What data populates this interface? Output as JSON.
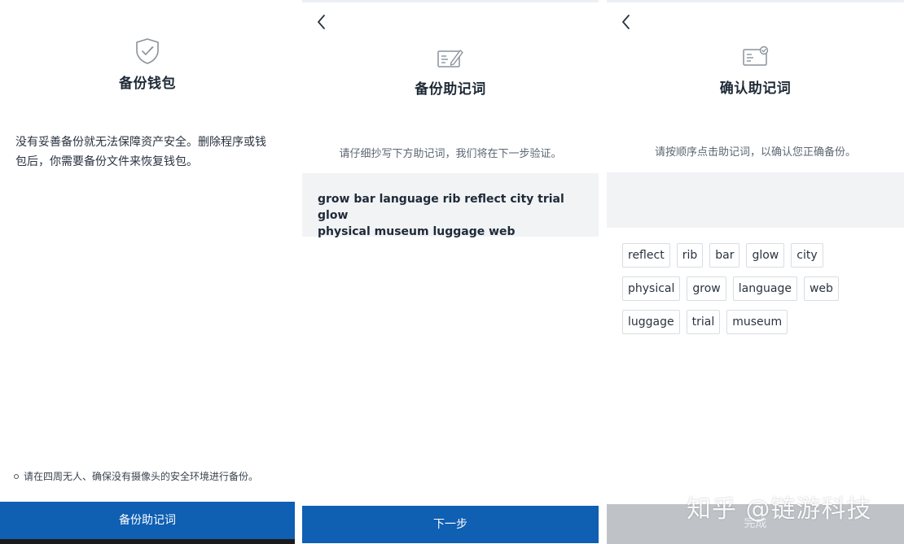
{
  "screen1": {
    "title": "备份钱包",
    "icon": "shield-check-icon",
    "body": "没有妥善备份就无法保障资产安全。删除程序或钱包后，你需要备份文件来恢复钱包。",
    "footnote": "请在四周无人、确保没有摄像头的安全环境进行备份。",
    "button_label": "备份助记词"
  },
  "screen2": {
    "back_icon": "chevron-left-icon",
    "icon": "note-edit-icon",
    "title": "备份助记词",
    "hint": "请仔细抄写下方助记词，我们将在下一步验证。",
    "mnemonic_line1": "grow bar language rib reflect city trial glow",
    "mnemonic_line2": "physical museum luggage web",
    "button_label": "下一步"
  },
  "screen3": {
    "back_icon": "chevron-left-icon",
    "icon": "note-check-icon",
    "title": "确认助记词",
    "hint": "请按顺序点击助记词，以确认您正确备份。",
    "words": [
      "reflect",
      "rib",
      "bar",
      "glow",
      "city",
      "physical",
      "grow",
      "language",
      "web",
      "luggage",
      "trial",
      "museum"
    ],
    "button_label": "完成"
  },
  "watermark": "知乎 @链游科技",
  "colors": {
    "primary": "#0f5fb3",
    "disabled": "#bfc3c8",
    "text": "#1f2a37",
    "panel_bg": "#f1f3f5"
  }
}
